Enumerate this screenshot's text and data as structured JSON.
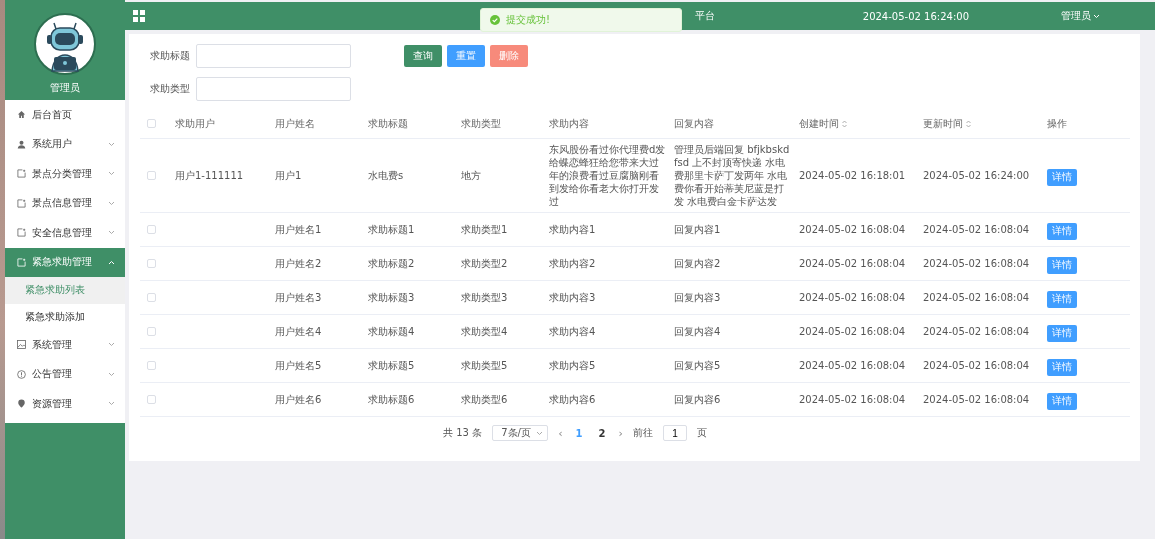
{
  "sidebar": {
    "user_name": "管理员",
    "items": [
      {
        "label": "后台首页",
        "kind": "home",
        "selected": false
      },
      {
        "label": "系统用户",
        "kind": "user",
        "selected": false,
        "expanded": false
      },
      {
        "label": "景点分类管理",
        "kind": "doc",
        "selected": false,
        "expanded": false
      },
      {
        "label": "景点信息管理",
        "kind": "doc",
        "selected": false,
        "expanded": false
      },
      {
        "label": "安全信息管理",
        "kind": "doc",
        "selected": false,
        "expanded": false
      },
      {
        "label": "紧急求助管理",
        "kind": "doc",
        "selected": true,
        "expanded": true,
        "children": [
          {
            "label": "紧急求助列表",
            "selected": true
          },
          {
            "label": "紧急求助添加",
            "selected": false
          }
        ]
      },
      {
        "label": "系统管理",
        "kind": "image",
        "selected": false,
        "expanded": false
      },
      {
        "label": "公告管理",
        "kind": "info",
        "selected": false,
        "expanded": false
      },
      {
        "label": "资源管理",
        "kind": "pin",
        "selected": false,
        "expanded": false
      }
    ]
  },
  "header": {
    "title": "平台",
    "datetime": "2024-05-02 16:24:00",
    "user": "管理员"
  },
  "toast": {
    "kind": "success",
    "message": "提交成功!"
  },
  "search": {
    "fields": [
      {
        "label": "求助标题"
      },
      {
        "label": "求助类型"
      }
    ],
    "buttons": [
      {
        "label": "查询",
        "kind": "primary"
      },
      {
        "label": "重置",
        "kind": "info"
      },
      {
        "label": "删除",
        "kind": "danger"
      }
    ]
  },
  "table": {
    "all_checked": false,
    "columns": [
      {
        "label": "求助用户",
        "sortable": false
      },
      {
        "label": "用户姓名",
        "sortable": false
      },
      {
        "label": "求助标题",
        "sortable": false
      },
      {
        "label": "求助类型",
        "sortable": false
      },
      {
        "label": "求助内容",
        "sortable": false
      },
      {
        "label": "回复内容",
        "sortable": false
      },
      {
        "label": "创建时间",
        "sortable": true
      },
      {
        "label": "更新时间",
        "sortable": true
      },
      {
        "label": "操作",
        "sortable": false
      }
    ],
    "rows": [
      {
        "checked": false,
        "cells": [
          "用户1-111111",
          "用户1",
          "水电费s",
          "地方",
          "东风股份看过你代理费d发给蝶恋蜂狂给您带来大过年的浪费看过豆腐脑刚看到发给你看老大你打开发过",
          "管理员后端回复 bfjkbskdfsd 上不封顶寄快递 水电费那里卡萨丁发两年 水电费你看开始蒂芙尼蓝是打发 水电费白金卡萨达发",
          "2024-05-02 16:18:01",
          "2024-05-02 16:24:00"
        ],
        "action": "详情"
      },
      {
        "checked": false,
        "cells": [
          "",
          "用户姓名1",
          "求助标题1",
          "求助类型1",
          "求助内容1",
          "回复内容1",
          "2024-05-02 16:08:04",
          "2024-05-02 16:08:04"
        ],
        "action": "详情"
      },
      {
        "checked": false,
        "cells": [
          "",
          "用户姓名2",
          "求助标题2",
          "求助类型2",
          "求助内容2",
          "回复内容2",
          "2024-05-02 16:08:04",
          "2024-05-02 16:08:04"
        ],
        "action": "详情"
      },
      {
        "checked": false,
        "cells": [
          "",
          "用户姓名3",
          "求助标题3",
          "求助类型3",
          "求助内容3",
          "回复内容3",
          "2024-05-02 16:08:04",
          "2024-05-02 16:08:04"
        ],
        "action": "详情"
      },
      {
        "checked": false,
        "cells": [
          "",
          "用户姓名4",
          "求助标题4",
          "求助类型4",
          "求助内容4",
          "回复内容4",
          "2024-05-02 16:08:04",
          "2024-05-02 16:08:04"
        ],
        "action": "详情"
      },
      {
        "checked": false,
        "cells": [
          "",
          "用户姓名5",
          "求助标题5",
          "求助类型5",
          "求助内容5",
          "回复内容5",
          "2024-05-02 16:08:04",
          "2024-05-02 16:08:04"
        ],
        "action": "详情"
      },
      {
        "checked": false,
        "cells": [
          "",
          "用户姓名6",
          "求助标题6",
          "求助类型6",
          "求助内容6",
          "回复内容6",
          "2024-05-02 16:08:04",
          "2024-05-02 16:08:04"
        ],
        "action": "详情"
      }
    ]
  },
  "pagination": {
    "total": "共 13 条",
    "page_size": "7条/页",
    "prev": "‹",
    "pages": [
      {
        "label": "1",
        "selected": true
      },
      {
        "label": "2",
        "selected": false
      }
    ],
    "next": "›",
    "goto_label": "前往",
    "goto_value": "1",
    "goto_suffix": "页"
  }
}
